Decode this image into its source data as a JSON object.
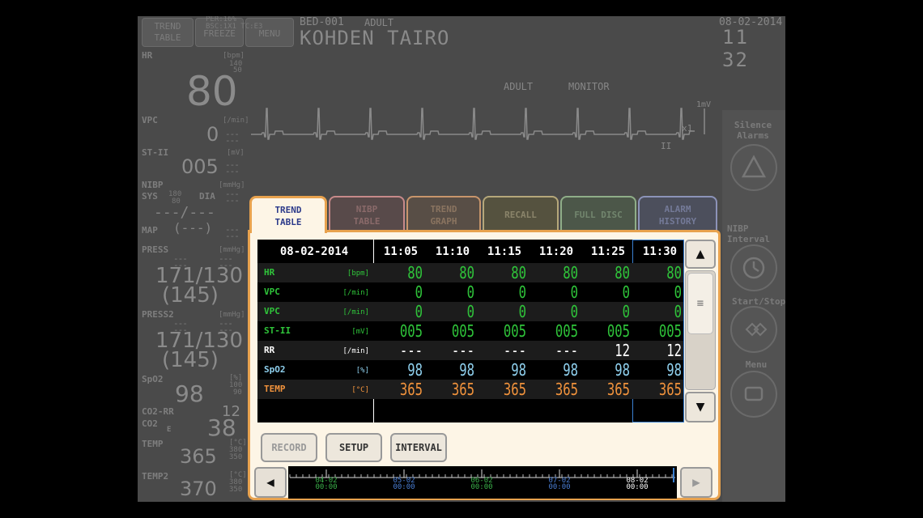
{
  "header": {
    "top_buttons": [
      {
        "label": "TREND TABLE",
        "name": "trend-table-top-button"
      },
      {
        "label": "FREEZE",
        "name": "freeze-button"
      },
      {
        "label": "MENU",
        "name": "menu-top-button"
      }
    ],
    "status_text": "PER:16%\nBSC:1X1 TC:E3",
    "bed": "BED-001",
    "category": "ADULT",
    "patient_name": "KOHDEN TAIRO",
    "date": "08-02-2014",
    "time": "11 32"
  },
  "waveform": {
    "label1": "ADULT",
    "label2": "MONITOR",
    "scale": "1mV",
    "gain": "x1",
    "lead": "II"
  },
  "vitals": {
    "hr": {
      "label": "HR",
      "unit": "[bpm]",
      "value": "80",
      "limit_hi": "140",
      "limit_lo": "50"
    },
    "vpc": {
      "label": "VPC",
      "unit": "[/min]",
      "value": "0"
    },
    "st": {
      "label": "ST-II",
      "unit": "[mV]",
      "value": "005"
    },
    "nibp": {
      "label": "NIBP",
      "unit": "[mmHg]",
      "sys_label": "SYS",
      "dia_label": "DIA",
      "limit_hi": "180",
      "limit_lo": "80",
      "value": "---/---",
      "map_label": "MAP",
      "map_value": "(---)"
    },
    "press": {
      "label": "PRESS",
      "unit": "[mmHg]",
      "value": "171/130",
      "mean": "(145)"
    },
    "press2": {
      "label": "PRESS2",
      "unit": "[mmHg]",
      "value": "171/130",
      "mean": "(145)"
    },
    "spo2": {
      "label": "SpO2",
      "unit": "[%]",
      "value": "98",
      "limit_hi": "100",
      "limit_lo": "90"
    },
    "co2rr": {
      "label": "CO2-RR",
      "value": "12"
    },
    "co2": {
      "label": "CO2",
      "value": "38",
      "flag": "E"
    },
    "temp": {
      "label": "TEMP",
      "unit": "[°C]",
      "value": "365",
      "limit_hi": "380",
      "limit_lo": "350"
    },
    "temp2": {
      "label": "TEMP2",
      "unit": "[°C]",
      "value": "370",
      "limit_hi": "380",
      "limit_lo": "350"
    }
  },
  "right_panel": {
    "silence": "Silence\nAlarms",
    "nibp_interval": "NIBP\nInterval",
    "start_stop": "Start/Stop",
    "menu": "Menu"
  },
  "tabs": [
    {
      "label": "TREND\nTABLE",
      "active": true
    },
    {
      "label": "NIBP\nTABLE",
      "active": false,
      "color": "#c78a8a"
    },
    {
      "label": "TREND\nGRAPH",
      "active": false,
      "color": "#c8956b"
    },
    {
      "label": "RECALL",
      "active": false,
      "color": "#b5a77a"
    },
    {
      "label": "FULL DISC",
      "active": false,
      "color": "#8fae88"
    },
    {
      "label": "ALARM\nHISTORY",
      "active": false,
      "color": "#8c93b8"
    }
  ],
  "trend_table": {
    "date": "08-02-2014",
    "times": [
      "11:05",
      "11:10",
      "11:15",
      "11:20",
      "11:25",
      "11:30"
    ],
    "rows": [
      {
        "label": "HR",
        "unit": "[bpm]",
        "color": "#2fc43a",
        "values": [
          "80",
          "80",
          "80",
          "80",
          "80",
          "80"
        ]
      },
      {
        "label": "VPC",
        "unit": "[/min]",
        "color": "#2fc43a",
        "values": [
          "0",
          "0",
          "0",
          "0",
          "0",
          "0"
        ]
      },
      {
        "label": "VPC",
        "unit": "[/min]",
        "color": "#2fc43a",
        "values": [
          "0",
          "0",
          "0",
          "0",
          "0",
          "0"
        ]
      },
      {
        "label": "ST-II",
        "unit": "[mV]",
        "color": "#2fc43a",
        "values": [
          "005",
          "005",
          "005",
          "005",
          "005",
          "005"
        ]
      },
      {
        "label": "RR",
        "unit": "[/min]",
        "color": "#ffffff",
        "values": [
          "---",
          "---",
          "---",
          "---",
          "12",
          "12"
        ]
      },
      {
        "label": "SpO2",
        "unit": "[%]",
        "color": "#8fd0ee",
        "values": [
          "98",
          "98",
          "98",
          "98",
          "98",
          "98"
        ]
      },
      {
        "label": "TEMP",
        "unit": "[°C]",
        "color": "#f0923c",
        "values": [
          "365",
          "365",
          "365",
          "365",
          "365",
          "365"
        ]
      }
    ]
  },
  "buttons": {
    "record": "RECORD",
    "setup": "SETUP",
    "interval": "INTERVAL"
  },
  "timeline": [
    {
      "date": "04-02",
      "time": "00:00",
      "color": "#3bb24a"
    },
    {
      "date": "05-02",
      "time": "00:00",
      "color": "#4a7fd6"
    },
    {
      "date": "06-02",
      "time": "00:00",
      "color": "#3bb24a"
    },
    {
      "date": "07-02",
      "time": "00:00",
      "color": "#4a7fd6"
    },
    {
      "date": "08-02",
      "time": "00:00",
      "color": "#ffffff"
    }
  ],
  "icons": {
    "up": "▲",
    "down": "▼",
    "left": "◀",
    "right": "▶",
    "scroll_grip": "≡"
  },
  "colors": {
    "accent": "#e8a24e",
    "selected_col": "#3a7fd0"
  }
}
